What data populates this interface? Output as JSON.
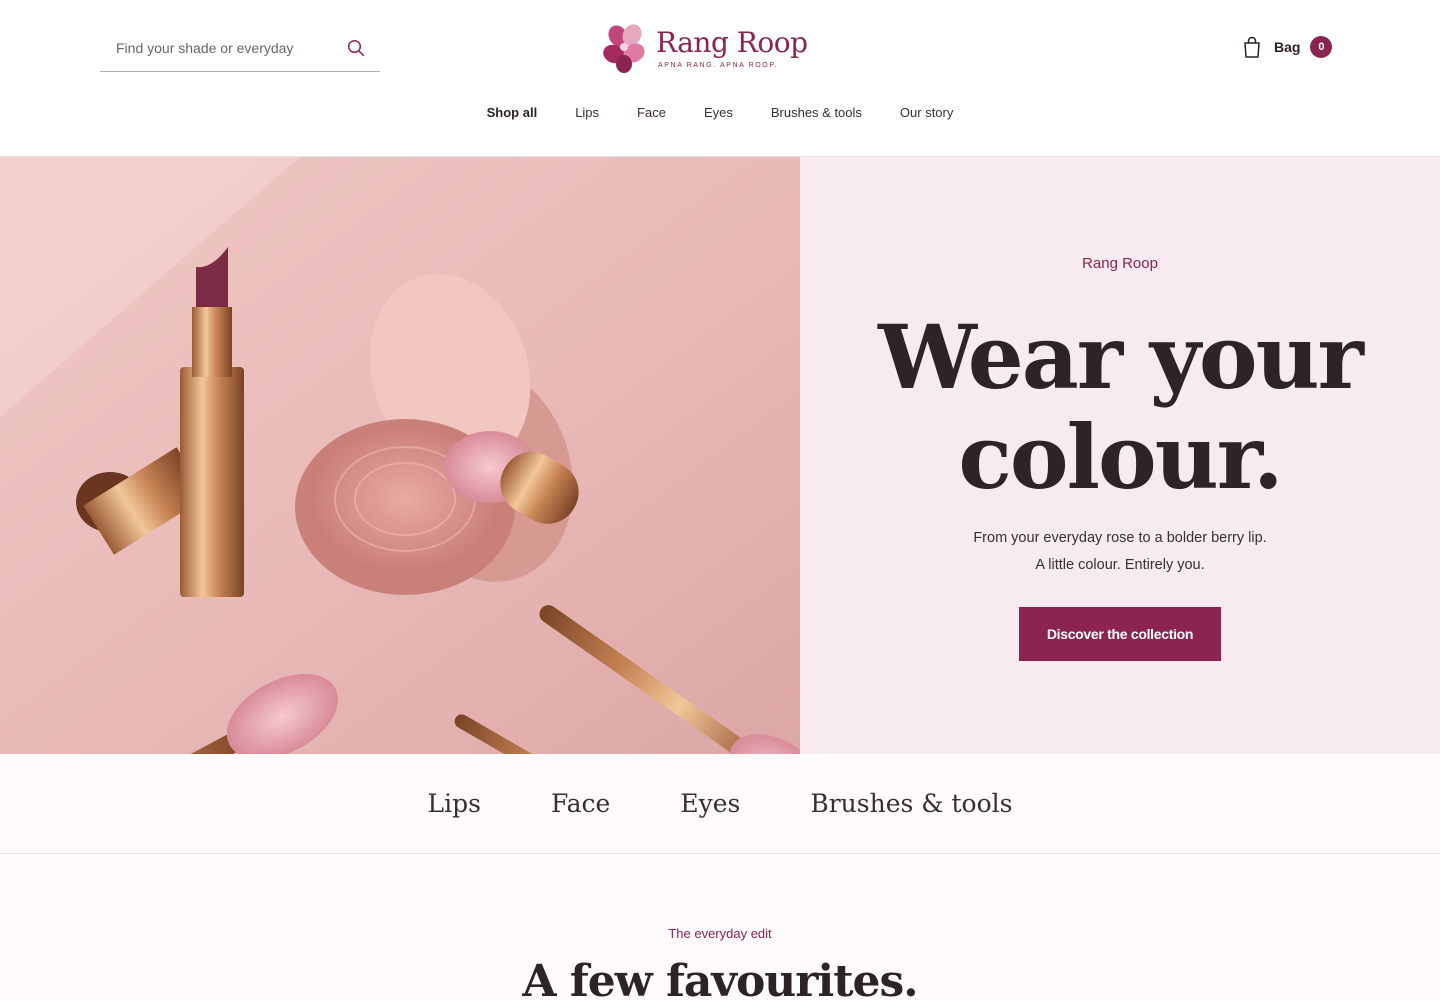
{
  "search": {
    "placeholder": "Find your shade or everyday",
    "icon": "search-icon"
  },
  "logo": {
    "brand": "Rang Roop",
    "tagline": "APNA RANG. APNA ROOP."
  },
  "bag": {
    "label": "Bag",
    "count": "0",
    "icon": "shopping-bag-icon"
  },
  "nav": {
    "items": [
      {
        "label": "Shop all",
        "active": true
      },
      {
        "label": "Lips"
      },
      {
        "label": "Face"
      },
      {
        "label": "Eyes"
      },
      {
        "label": "Brushes & tools"
      },
      {
        "label": "Our story"
      }
    ]
  },
  "hero": {
    "eyebrow": "Rang Roop",
    "title_line1": "Wear your",
    "title_line2": "colour.",
    "sub_line1": "From your everyday rose to a bolder berry lip.",
    "sub_line2": "A little colour. Entirely you.",
    "cta": "Discover the collection"
  },
  "categories": [
    "Lips",
    "Face",
    "Eyes",
    "Brushes & tools"
  ],
  "favourites": {
    "eyebrow": "The everyday edit",
    "title": "A few favourites."
  },
  "colors": {
    "accent": "#8b2450",
    "hero_panel": "#f8ebef",
    "text_dark": "#2e2328"
  }
}
